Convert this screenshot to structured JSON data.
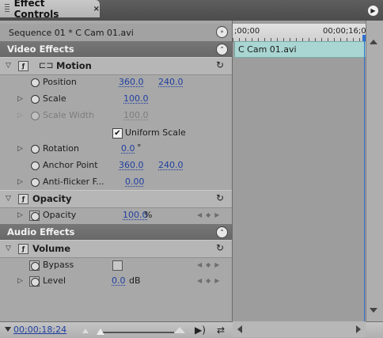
{
  "panel": {
    "title": "Effect Controls",
    "close_glyph": "×"
  },
  "sequence": {
    "label": "Sequence 01 * C Cam 01.avi"
  },
  "timeline": {
    "ruler_start": ";00;00",
    "ruler_end": "00;00;16;0",
    "clip_name": "C Cam 01.avi"
  },
  "video_effects": {
    "header": "Video Effects",
    "motion": {
      "label": "Motion",
      "position": {
        "label": "Position",
        "x": "360.0",
        "y": "240.0"
      },
      "scale": {
        "label": "Scale",
        "value": "100.0"
      },
      "scale_width": {
        "label": "Scale Width",
        "value": "100.0"
      },
      "uniform_scale": {
        "label": "Uniform Scale",
        "checked": true
      },
      "rotation": {
        "label": "Rotation",
        "value": "0.0",
        "unit": "°"
      },
      "anchor_point": {
        "label": "Anchor Point",
        "x": "360.0",
        "y": "240.0"
      },
      "anti_flicker": {
        "label": "Anti-flicker F...",
        "value": "0.00"
      }
    },
    "opacity": {
      "label": "Opacity",
      "opacity": {
        "label": "Opacity",
        "value": "100.0",
        "unit": "%"
      }
    }
  },
  "audio_effects": {
    "header": "Audio Effects",
    "volume": {
      "label": "Volume",
      "bypass": {
        "label": "Bypass"
      },
      "level": {
        "label": "Level",
        "value": "0.0",
        "unit": "dB"
      }
    }
  },
  "footer": {
    "timecode": "00;00;18;24"
  },
  "colors": {
    "value_link": "#1f3fa0",
    "clip_bar": "#a9d6d2",
    "playhead": "#2d6fd0",
    "section_header": "#6e6e6e"
  }
}
